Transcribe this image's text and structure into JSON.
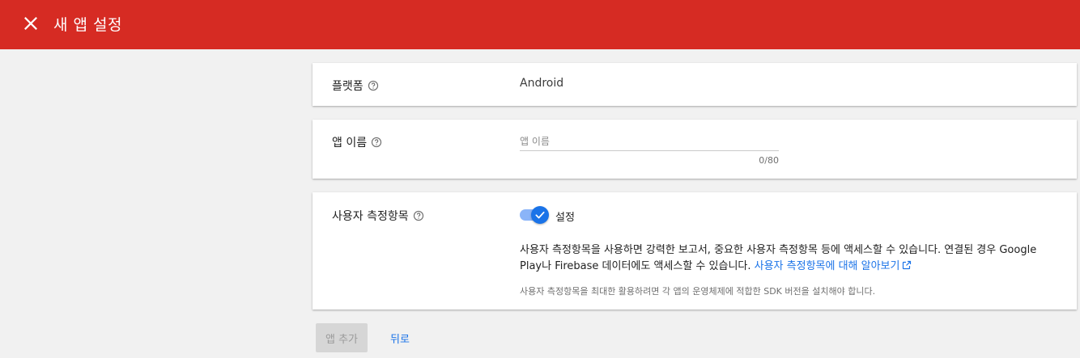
{
  "header": {
    "title": "새 앱 설정",
    "close_icon": "close-icon",
    "background_color": "#d62b23"
  },
  "platform": {
    "label": "플랫폼",
    "value": "Android",
    "help_icon": "help-circle-icon"
  },
  "app_name": {
    "label": "앱 이름",
    "placeholder": "앱 이름",
    "value": "",
    "counter": "0/80",
    "help_icon": "help-circle-icon"
  },
  "user_metrics": {
    "label": "사용자 측정항목",
    "help_icon": "help-circle-icon",
    "toggle_on": true,
    "toggle_label": "설정",
    "description": "사용자 측정항목을 사용하면 강력한 보고서, 중요한 사용자 측정항목 등에 액세스할 수 있습니다. 연결된 경우 Google Play나 Firebase 데이터에도 액세스할 수 있습니다.",
    "link_text": "사용자 측정항목에 대해 알아보기",
    "link_icon": "external-link-icon",
    "note": "사용자 측정항목을 최대한 활용하려면 각 앱의 운영체제에 적합한 SDK 버전을 설치해야 합니다.",
    "accent_color": "#1a73e8"
  },
  "actions": {
    "add_label": "앱 추가",
    "add_disabled": true,
    "back_label": "뒤로"
  }
}
